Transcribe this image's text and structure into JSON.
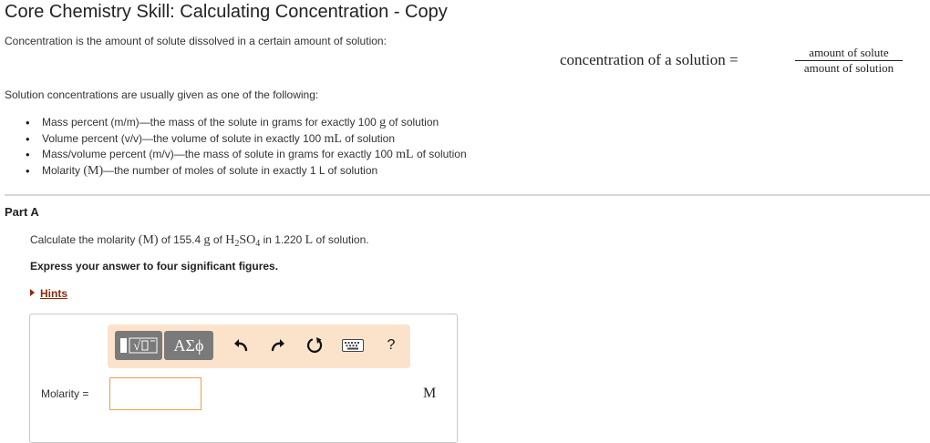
{
  "header": {
    "title": "Core Chemistry Skill: Calculating Concentration - Copy",
    "intro": "Concentration is the amount of solute dissolved in a certain amount of solution:"
  },
  "formula": {
    "lhs": "concentration of a solution =",
    "numerator": "amount of solute",
    "denominator": "amount of solution"
  },
  "list_intro": "Solution concentrations are usually given as one of the following:",
  "bullets": [
    {
      "before": "Mass percent (m/m)—the mass of the solute in grams for exactly 100 ",
      "unit": "g",
      "after": " of solution"
    },
    {
      "before": "Volume percent (v/v)—the volume of solute in exactly 100 ",
      "unit": "mL",
      "after": " of solution"
    },
    {
      "before": "Mass/volume percent (m/v)—the mass of solute in grams for exactly 100 ",
      "unit": "mL",
      "after": " of solution"
    },
    {
      "before": "Molarity ",
      "unit": "(M)",
      "after": "—the number of moles of solute in exactly 1 L of solution"
    }
  ],
  "part": {
    "label": "Part A",
    "question": {
      "t1": "Calculate the molarity ",
      "m1": "(M)",
      "t2": " of 155.4 ",
      "m2": "g",
      "t3": " of ",
      "f1": "H",
      "s1": "2",
      "f2": "SO",
      "s2": "4",
      "t4": " in 1.220 ",
      "m3": "L",
      "t5": " of solution."
    },
    "instruction": "Express your answer to four significant figures.",
    "hints_label": "Hints"
  },
  "toolbar": {
    "symbols_label": "ΑΣϕ",
    "help_label": "?",
    "icons": [
      "templates-icon",
      "symbols-icon",
      "undo-icon",
      "redo-icon",
      "reset-icon",
      "keyboard-icon",
      "help-icon"
    ]
  },
  "answer": {
    "label": "Molarity =",
    "value": "",
    "unit": "M"
  },
  "colors": {
    "hint_link": "#8c2b0c",
    "toolbar_bg": "#fbe3cb",
    "button_bg": "#7a7a7a",
    "input_border": "#e8a24a"
  }
}
